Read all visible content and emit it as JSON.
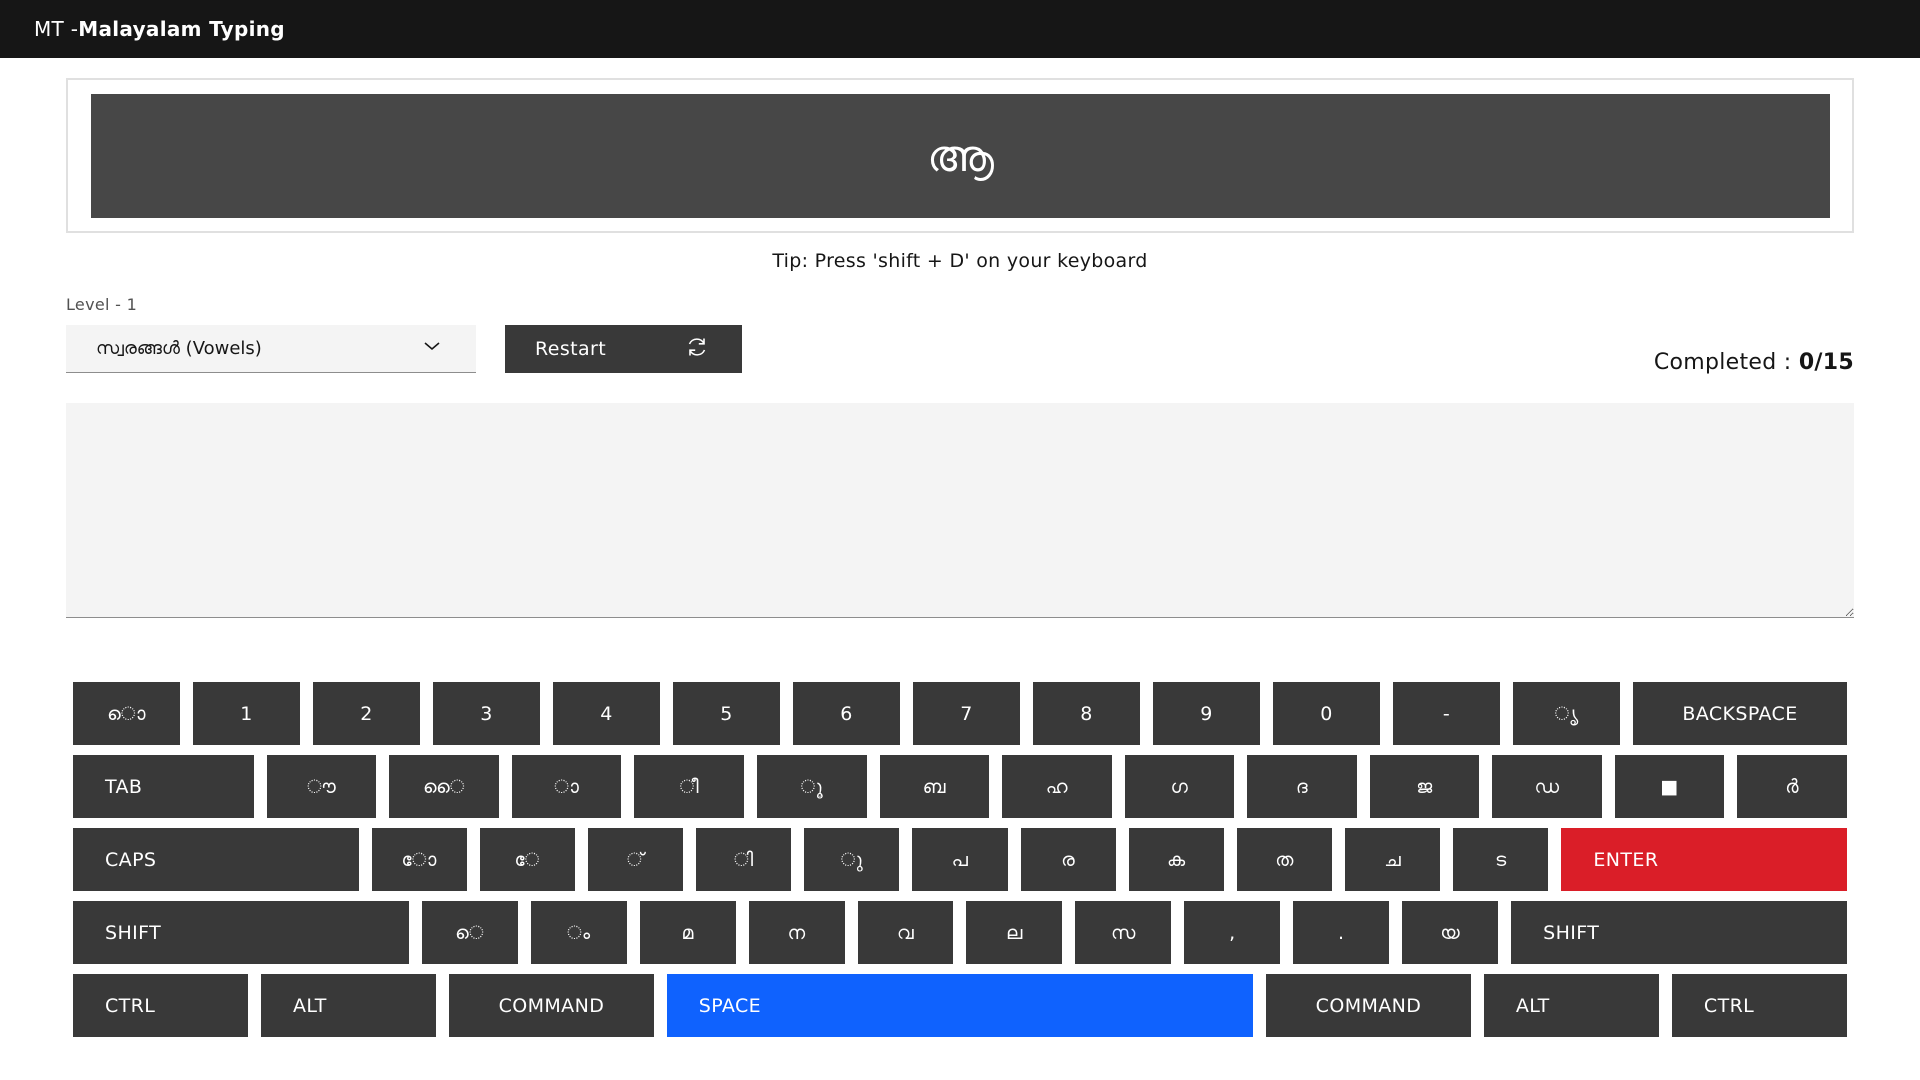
{
  "app": {
    "title_prefix": "MT - ",
    "title_name": "Malayalam Typing"
  },
  "display": {
    "current_char": "ആ"
  },
  "tip": "Tip: Press 'shift + D' on your keyboard",
  "level": {
    "label": "Level - 1",
    "selected": "സ്വരങ്ങൾ (Vowels)"
  },
  "restart_label": "Restart",
  "progress": {
    "label": "Completed : ",
    "value": "0/15"
  },
  "keyboard": {
    "rows": [
      [
        {
          "label": "ൊ",
          "w": 1
        },
        {
          "label": "1",
          "w": 1
        },
        {
          "label": "2",
          "w": 1
        },
        {
          "label": "3",
          "w": 1
        },
        {
          "label": "4",
          "w": 1
        },
        {
          "label": "5",
          "w": 1
        },
        {
          "label": "6",
          "w": 1
        },
        {
          "label": "7",
          "w": 1
        },
        {
          "label": "8",
          "w": 1
        },
        {
          "label": "9",
          "w": 1
        },
        {
          "label": "0",
          "w": 1
        },
        {
          "label": "-",
          "w": 1
        },
        {
          "label": "ൃ",
          "w": 1
        },
        {
          "label": "BACKSPACE",
          "w": 2
        }
      ],
      [
        {
          "label": "TAB",
          "w": 1.65,
          "align": "left"
        },
        {
          "label": "ൗ",
          "w": 1
        },
        {
          "label": "ൈ",
          "w": 1
        },
        {
          "label": "ാ",
          "w": 1
        },
        {
          "label": "ീ",
          "w": 1
        },
        {
          "label": "ൂ",
          "w": 1
        },
        {
          "label": "ബ",
          "w": 1
        },
        {
          "label": "ഹ",
          "w": 1
        },
        {
          "label": "ഗ",
          "w": 1
        },
        {
          "label": "ദ",
          "w": 1
        },
        {
          "label": "ജ",
          "w": 1
        },
        {
          "label": "ഡ",
          "w": 1
        },
        {
          "label": "■",
          "w": 1
        },
        {
          "label": "ർ",
          "w": 1
        }
      ],
      [
        {
          "label": "CAPS",
          "w": 3,
          "align": "left"
        },
        {
          "label": "ോ",
          "w": 1
        },
        {
          "label": "േ",
          "w": 1
        },
        {
          "label": "്",
          "w": 1
        },
        {
          "label": "ി",
          "w": 1
        },
        {
          "label": "ു",
          "w": 1
        },
        {
          "label": "പ",
          "w": 1
        },
        {
          "label": "ര",
          "w": 1
        },
        {
          "label": "ക",
          "w": 1
        },
        {
          "label": "ത",
          "w": 1
        },
        {
          "label": "ച",
          "w": 1
        },
        {
          "label": "ട",
          "w": 1
        },
        {
          "label": "ENTER",
          "w": 3,
          "align": "left",
          "kind": "enter"
        }
      ],
      [
        {
          "label": "SHIFT",
          "w": 3.5,
          "align": "left"
        },
        {
          "label": "െ",
          "w": 1
        },
        {
          "label": "ം",
          "w": 1
        },
        {
          "label": "മ",
          "w": 1
        },
        {
          "label": "ന",
          "w": 1
        },
        {
          "label": "വ",
          "w": 1
        },
        {
          "label": "ല",
          "w": 1
        },
        {
          "label": "സ",
          "w": 1
        },
        {
          "label": ",",
          "w": 1
        },
        {
          "label": ".",
          "w": 1
        },
        {
          "label": "യ",
          "w": 1
        },
        {
          "label": "SHIFT",
          "w": 3.5,
          "align": "left"
        }
      ],
      [
        {
          "label": "CTRL",
          "w": 1,
          "align": "left"
        },
        {
          "label": "ALT",
          "w": 1,
          "align": "left"
        },
        {
          "label": "COMMAND",
          "w": 1.17
        },
        {
          "label": "SPACE",
          "w": 3.35,
          "align": "left",
          "kind": "space"
        },
        {
          "label": "COMMAND",
          "w": 1.17
        },
        {
          "label": "ALT",
          "w": 1,
          "align": "left"
        },
        {
          "label": "CTRL",
          "w": 1,
          "align": "left"
        }
      ]
    ]
  }
}
